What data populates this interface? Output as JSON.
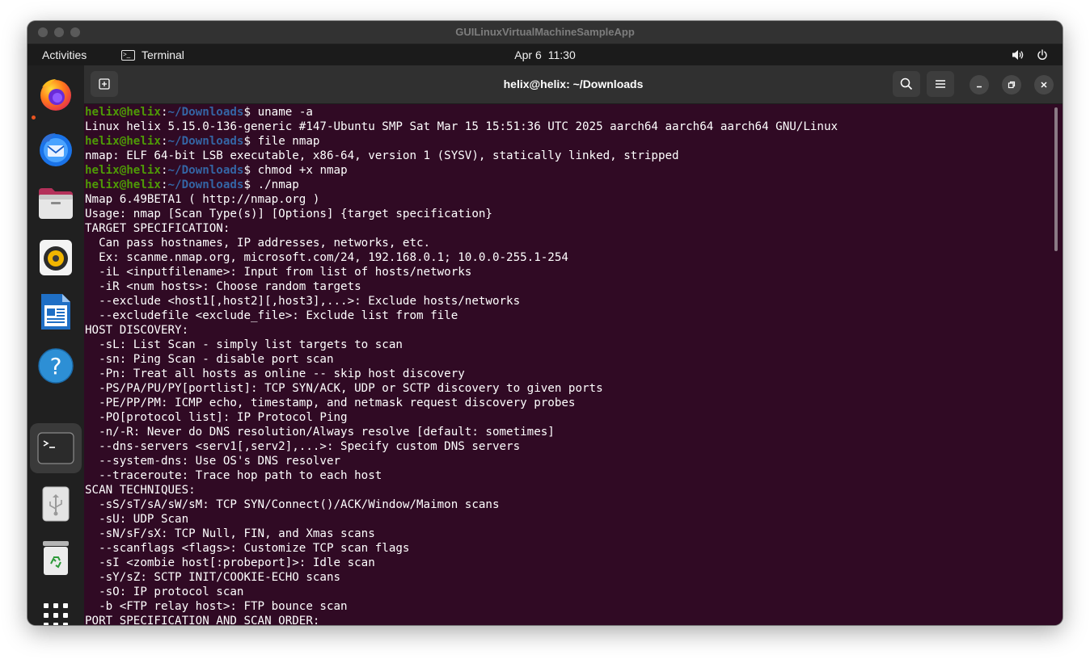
{
  "vm_window": {
    "title": "GUILinuxVirtualMachineSampleApp"
  },
  "topbar": {
    "activities_label": "Activities",
    "app_name": "Terminal",
    "date": "Apr 6",
    "time": "11:30",
    "icons": [
      "volume-icon",
      "power-icon"
    ]
  },
  "dock": {
    "items": [
      {
        "name": "firefox",
        "icon": "firefox-icon",
        "running": true
      },
      {
        "name": "thunderbird",
        "icon": "thunderbird-mail-icon",
        "running": false
      },
      {
        "name": "files",
        "icon": "files-folder-icon",
        "running": false
      },
      {
        "name": "rhythmbox",
        "icon": "rhythmbox-speaker-icon",
        "running": false
      },
      {
        "name": "libreoffice-writer",
        "icon": "writer-document-icon",
        "running": false
      },
      {
        "name": "help",
        "icon": "help-icon",
        "running": false
      },
      {
        "name": "terminal",
        "icon": "terminal-icon",
        "running": true,
        "active": true
      },
      {
        "name": "usb-drive",
        "icon": "usb-drive-icon",
        "running": false
      },
      {
        "name": "trash",
        "icon": "trash-icon",
        "running": false
      },
      {
        "name": "show-apps",
        "icon": "app-grid-icon",
        "running": false
      }
    ]
  },
  "terminal": {
    "title": "helix@helix: ~/Downloads",
    "header_icons": [
      "new-tab-icon",
      "search-icon",
      "menu-icon",
      "minimize-icon",
      "maximize-icon",
      "close-icon"
    ],
    "colors": {
      "background": "#300a24",
      "prompt_user": "#4e9a06",
      "prompt_path": "#3465a4",
      "text": "#ffffff"
    },
    "lines": [
      {
        "user": "helix@helix",
        "path": "~/Downloads",
        "cmd": "$ uname -a"
      },
      {
        "text": "Linux helix 5.15.0-136-generic #147-Ubuntu SMP Sat Mar 15 15:51:36 UTC 2025 aarch64 aarch64 aarch64 GNU/Linux"
      },
      {
        "user": "helix@helix",
        "path": "~/Downloads",
        "cmd": "$ file nmap"
      },
      {
        "text": "nmap: ELF 64-bit LSB executable, x86-64, version 1 (SYSV), statically linked, stripped"
      },
      {
        "user": "helix@helix",
        "path": "~/Downloads",
        "cmd": "$ chmod +x nmap"
      },
      {
        "user": "helix@helix",
        "path": "~/Downloads",
        "cmd": "$ ./nmap"
      },
      {
        "text": "Nmap 6.49BETA1 ( http://nmap.org )"
      },
      {
        "text": "Usage: nmap [Scan Type(s)] [Options] {target specification}"
      },
      {
        "text": "TARGET SPECIFICATION:"
      },
      {
        "text": "  Can pass hostnames, IP addresses, networks, etc."
      },
      {
        "text": "  Ex: scanme.nmap.org, microsoft.com/24, 192.168.0.1; 10.0.0-255.1-254"
      },
      {
        "text": "  -iL <inputfilename>: Input from list of hosts/networks"
      },
      {
        "text": "  -iR <num hosts>: Choose random targets"
      },
      {
        "text": "  --exclude <host1[,host2][,host3],...>: Exclude hosts/networks"
      },
      {
        "text": "  --excludefile <exclude_file>: Exclude list from file"
      },
      {
        "text": "HOST DISCOVERY:"
      },
      {
        "text": "  -sL: List Scan - simply list targets to scan"
      },
      {
        "text": "  -sn: Ping Scan - disable port scan"
      },
      {
        "text": "  -Pn: Treat all hosts as online -- skip host discovery"
      },
      {
        "text": "  -PS/PA/PU/PY[portlist]: TCP SYN/ACK, UDP or SCTP discovery to given ports"
      },
      {
        "text": "  -PE/PP/PM: ICMP echo, timestamp, and netmask request discovery probes"
      },
      {
        "text": "  -PO[protocol list]: IP Protocol Ping"
      },
      {
        "text": "  -n/-R: Never do DNS resolution/Always resolve [default: sometimes]"
      },
      {
        "text": "  --dns-servers <serv1[,serv2],...>: Specify custom DNS servers"
      },
      {
        "text": "  --system-dns: Use OS's DNS resolver"
      },
      {
        "text": "  --traceroute: Trace hop path to each host"
      },
      {
        "text": "SCAN TECHNIQUES:"
      },
      {
        "text": "  -sS/sT/sA/sW/sM: TCP SYN/Connect()/ACK/Window/Maimon scans"
      },
      {
        "text": "  -sU: UDP Scan"
      },
      {
        "text": "  -sN/sF/sX: TCP Null, FIN, and Xmas scans"
      },
      {
        "text": "  --scanflags <flags>: Customize TCP scan flags"
      },
      {
        "text": "  -sI <zombie host[:probeport]>: Idle scan"
      },
      {
        "text": "  -sY/sZ: SCTP INIT/COOKIE-ECHO scans"
      },
      {
        "text": "  -sO: IP protocol scan"
      },
      {
        "text": "  -b <FTP relay host>: FTP bounce scan"
      },
      {
        "text": "PORT SPECIFICATION AND SCAN ORDER:"
      }
    ]
  }
}
